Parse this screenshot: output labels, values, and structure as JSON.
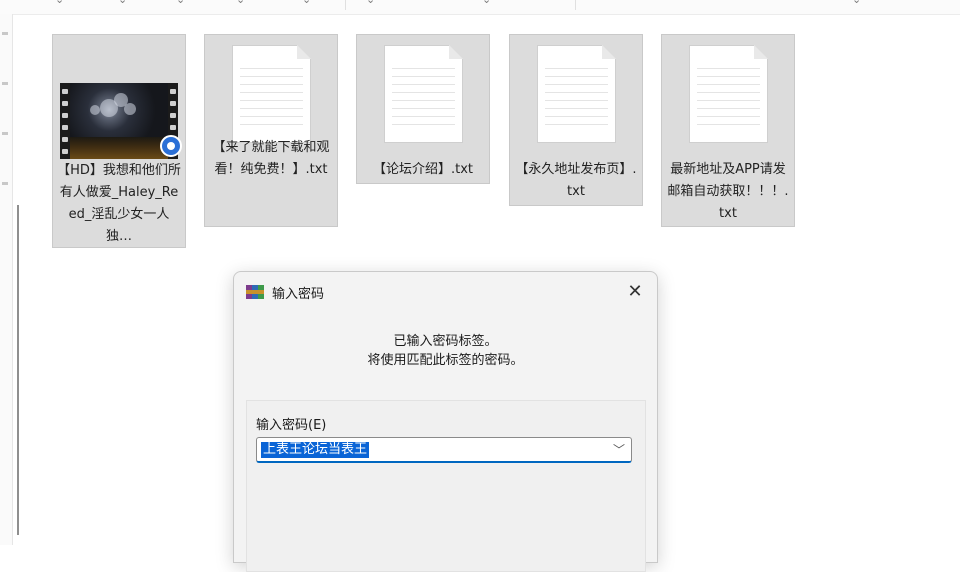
{
  "files": [
    {
      "name": "【HD】我想和他们所有人做爱_Haley_Reed_淫乱少女一人独…",
      "type": "video",
      "badge": "sync-icon"
    },
    {
      "name": "【来了就能下载和观看！纯免费！】.txt",
      "type": "text"
    },
    {
      "name": "【论坛介绍】.txt",
      "type": "text"
    },
    {
      "name": "【永久地址发布页】.txt",
      "type": "text"
    },
    {
      "name": "最新地址及APP请发邮箱自动获取！！！.txt",
      "type": "text"
    }
  ],
  "dialog": {
    "title": "输入密码",
    "message_line1": "已输入密码标签。",
    "message_line2": "将使用匹配此标签的密码。",
    "field_label": "输入密码(E)",
    "password_value": "上表王论坛当表王"
  }
}
